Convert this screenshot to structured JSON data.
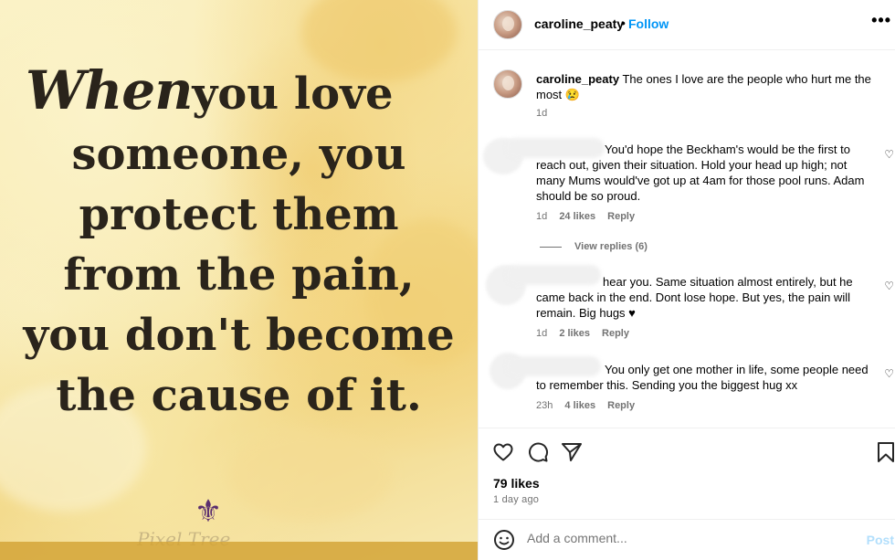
{
  "image": {
    "quote_lines": [
      "Whenyou love",
      "someone, you",
      "protect them",
      "from the pain,",
      "you don't become",
      "the cause of it."
    ],
    "quote_first_script": "When",
    "quote_first_rest": "you love",
    "watermark": "Pixel Tree"
  },
  "header": {
    "username": "caroline_peaty",
    "separator": "•",
    "follow_label": "Follow",
    "more_icon": "more-horizontal-icon"
  },
  "caption": {
    "username": "caroline_peaty",
    "text": "The ones I love are the people who hurt me the most 😢",
    "time": "1d"
  },
  "comments": [
    {
      "text": "You'd hope the Beckham's would be the first to reach out, given their situation. Hold your head up high; not many Mums would've got up at 4am for those pool runs. Adam should be so proud.",
      "time": "1d",
      "likes": "24 likes",
      "reply": "Reply"
    },
    {
      "text": "hear you. Same situation almost entirely, but he came back in the end. Dont lose hope. But yes, the pain will remain. Big hugs ♥",
      "time": "1d",
      "likes": "2 likes",
      "reply": "Reply"
    },
    {
      "text": "You only get one mother in life, some people need to remember this. Sending you the biggest hug xx",
      "time": "23h",
      "likes": "4 likes",
      "reply": "Reply"
    }
  ],
  "view_replies": "View replies (6)",
  "footer": {
    "likes": "79 likes",
    "date": "1 day ago"
  },
  "add_comment": {
    "placeholder": "Add a comment...",
    "post_label": "Post"
  },
  "colors": {
    "follow": "#0095f6",
    "post_disabled": "#b2dffc",
    "meta": "#737373"
  }
}
